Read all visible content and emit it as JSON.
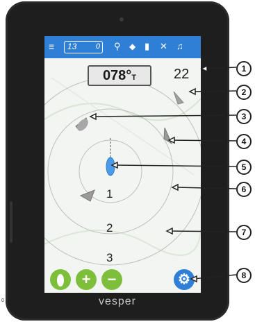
{
  "status_bar": {
    "menu_icon": "menu-icon",
    "range": "13",
    "range_unit": "0",
    "icons": [
      "gps-antenna-icon",
      "wifi-icon",
      "battery-icon",
      "satellite-off-icon",
      "bell-icon"
    ]
  },
  "heading": {
    "value": "078°",
    "unit": "T"
  },
  "speed": "22",
  "rings": [
    "1",
    "2",
    "3"
  ],
  "buttons": [
    {
      "name": "anchor-watch-button",
      "icon": "anchor-icon",
      "color": "#7dbf3a",
      "label": ""
    },
    {
      "name": "zoom-in-button",
      "icon": "plus-icon",
      "color": "#7dbf3a",
      "label": "+"
    },
    {
      "name": "zoom-out-button",
      "icon": "minus-icon",
      "color": "#7dbf3a",
      "label": "−"
    },
    {
      "name": "settings-button",
      "icon": "gear-icon",
      "color": "#2f7fd6",
      "label": ""
    }
  ],
  "brand": "vesper",
  "callouts": [
    "1",
    "2",
    "3",
    "4",
    "5",
    "6",
    "7",
    "8"
  ],
  "page_number": "0",
  "colors": {
    "topbar": "#2f7fd6",
    "green_btn": "#7dbf3a",
    "own_vessel": "#2f7fd6",
    "target": "#9a9a9a"
  }
}
